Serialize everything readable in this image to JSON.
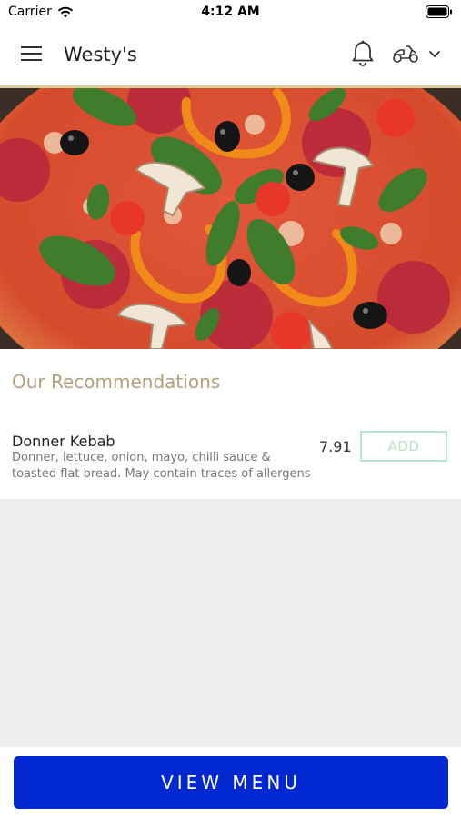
{
  "status": {
    "carrier": "Carrier",
    "time": "4:12 AM"
  },
  "header": {
    "store_name": "Westy's"
  },
  "recommendations": {
    "title": "Our Recommendations",
    "items": [
      {
        "name": "Donner Kebab",
        "description": "Donner, lettuce, onion, mayo, chilli sauce & toasted flat bread. May contain traces of allergens",
        "price": "7.91",
        "add_label": "ADD"
      }
    ]
  },
  "footer": {
    "view_menu_label": "VIEW MENU"
  },
  "colors": {
    "accent_blue": "#0027d0",
    "title_gold": "#b39f7c",
    "add_green": "#b6e4cc",
    "header_border": "#d8cf97"
  }
}
